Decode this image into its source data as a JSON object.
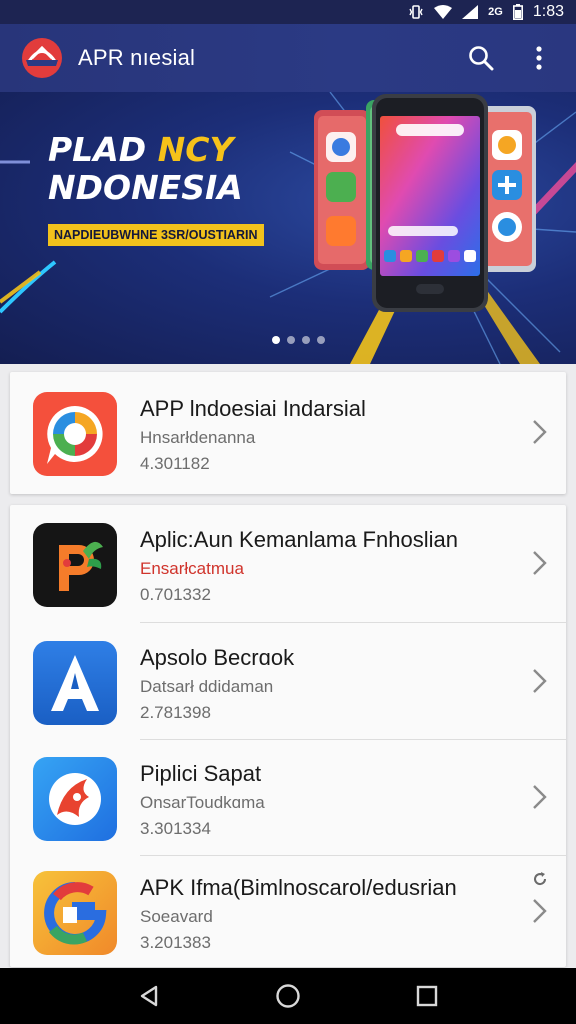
{
  "status_bar": {
    "time": "1:83",
    "network": "2G"
  },
  "app_bar": {
    "title": "APR nıesial"
  },
  "banner": {
    "title_line1_a": "PLAD ",
    "title_line1_b": "NCY",
    "title_line2": "NDONESIA",
    "subtitle": "NAPDIEUBWHNE 3SR/OUSTIARIN",
    "dots": 4,
    "active_dot": 0
  },
  "apps": [
    {
      "name": "APP lndoesiai Indarsial",
      "category": "Hnsarłdenanna",
      "version": "4.301182",
      "category_color": "gray"
    },
    {
      "name": "Aplic:Aun Kemanlama Fnhoslian",
      "category": "Ensarłcatmua",
      "version": "0.701332",
      "category_color": "red"
    },
    {
      "name": "Apsolo Becrɑok",
      "category": "Datsarł ddidaman",
      "version": "2.781398",
      "category_color": "gray"
    },
    {
      "name": "Piplici Sapat",
      "category": "OnsarToudkɑma",
      "version": "3.301334",
      "category_color": "gray"
    },
    {
      "name": "APK Ifma(Bimlnoscarol/edusrian",
      "category": "Soeavard",
      "version": "3.201383",
      "category_color": "gray"
    }
  ],
  "colors": {
    "app_bar": "#2b3a84",
    "status_bar": "#1d2452",
    "accent_yellow": "#f2c21c",
    "category_red": "#d0342c"
  }
}
